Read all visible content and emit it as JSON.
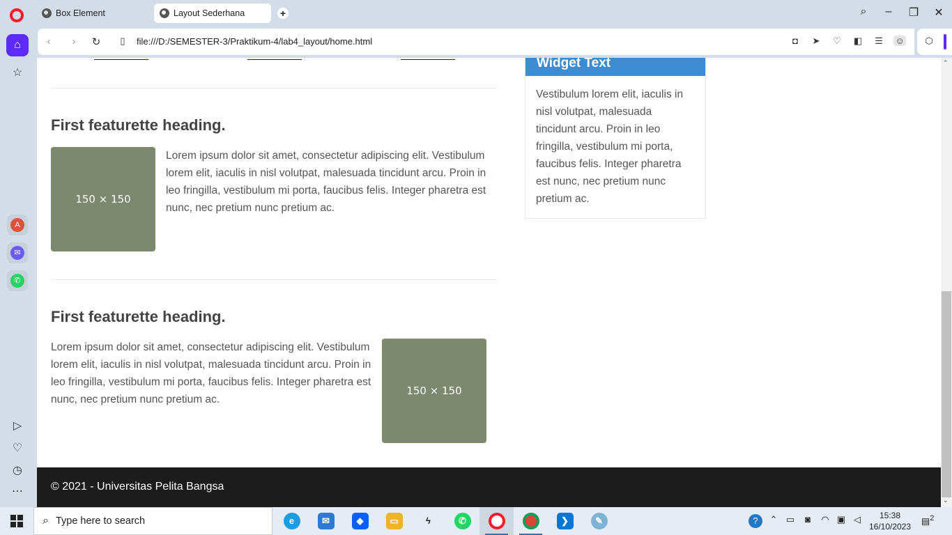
{
  "browser": {
    "tabs": [
      {
        "label": "Box Element"
      },
      {
        "label": "Layout Sederhana"
      }
    ],
    "url": "file:///D:/SEMESTER-3/Praktikum-4/lab4_layout/home.html"
  },
  "page": {
    "featurettes": [
      {
        "heading": "First featurette heading.",
        "text": "Lorem ipsum dolor sit amet, consectetur adipiscing elit. Vestibulum lorem elit, iaculis in nisl volutpat, malesuada tincidunt arcu. Proin in leo fringilla, vestibulum mi porta, faucibus felis. Integer pharetra est nunc, nec pretium nunc pretium ac.",
        "image_label": "150 × 150"
      },
      {
        "heading": "First featurette heading.",
        "text": "Lorem ipsum dolor sit amet, consectetur adipiscing elit. Vestibulum lorem elit, iaculis in nisl volutpat, malesuada tincidunt arcu. Proin in leo fringilla, vestibulum mi porta, faucibus felis. Integer pharetra est nunc, nec pretium nunc pretium ac.",
        "image_label": "150 × 150"
      }
    ],
    "widget": {
      "title": "Widget Text",
      "body": "Vestibulum lorem elit, iaculis in nisl volutpat, malesuada tincidunt arcu. Proin in leo fringilla, vestibulum mi porta, faucibus felis. Integer pharetra est nunc, nec pretium nunc pretium ac."
    },
    "footer": "© 2021 - Universitas Pelita Bangsa"
  },
  "taskbar": {
    "search_placeholder": "Type here to search",
    "time": "15:38",
    "date": "16/10/2023",
    "notification_count": "2"
  },
  "colors": {
    "widget_header": "#3d8bd0",
    "placeholder_image": "#7d886f",
    "footer_bg": "#1c1c1c",
    "opera_accent": "#5e2bff"
  }
}
